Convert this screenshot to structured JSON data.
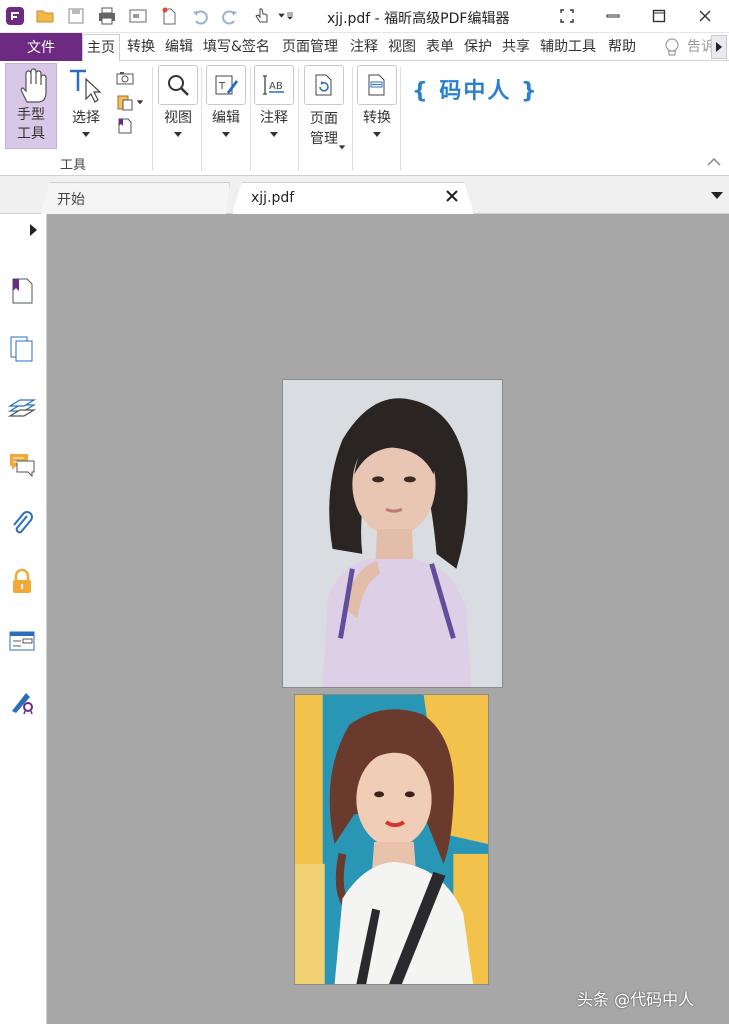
{
  "window": {
    "title": "xjj.pdf - 福昕高级PDF编辑器"
  },
  "quick_access": {
    "icons": [
      "foxit-logo-icon",
      "open-folder-icon",
      "save-icon",
      "print-icon",
      "email-icon",
      "new-document-icon",
      "undo-icon",
      "redo-icon",
      "hand-cursor-icon"
    ]
  },
  "menu": {
    "file": "文件",
    "items": [
      "主页",
      "转换",
      "编辑",
      "填写&签名",
      "页面管理",
      "注释",
      "视图",
      "表单",
      "保护",
      "共享",
      "辅助工具",
      "帮助"
    ],
    "tell_me": "告诉",
    "active_index": 0
  },
  "ribbon": {
    "hand_tool": "手型\n工具",
    "select": "选择",
    "group_label": "工具",
    "view": "视图",
    "edit": "编辑",
    "comment": "注释",
    "page_manage": "页面\n管理",
    "convert": "转换",
    "brand": "{ 码中人 }"
  },
  "tabs": {
    "start": "开始",
    "doc": "xjj.pdf"
  },
  "sidebar": {
    "icons": [
      "bookmark-icon",
      "pages-icon",
      "layers-icon",
      "comments-icon",
      "attachment-icon",
      "security-lock-icon",
      "form-fields-icon",
      "signature-icon"
    ]
  },
  "watermark": "头条 @代码中人",
  "colors": {
    "accent": "#6c2a82",
    "hand_tool_bg": "#d8c7e6",
    "doc_bg": "#a7a7a7",
    "brand": "#2a7fd0"
  }
}
